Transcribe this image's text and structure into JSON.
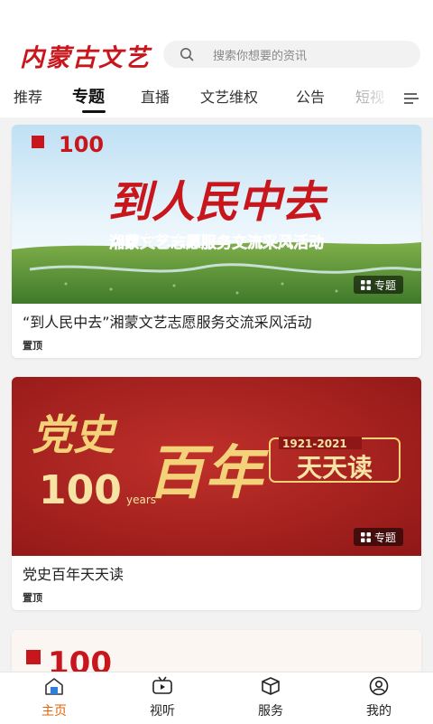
{
  "header": {
    "logo_text": "内蒙古文艺",
    "search_placeholder": "搜索你想要的资讯"
  },
  "tabs": [
    {
      "label": "推荐",
      "active": false
    },
    {
      "label": "专题",
      "active": true
    },
    {
      "label": "直播",
      "active": false
    },
    {
      "label": "文艺维权",
      "active": false
    },
    {
      "label": "公告",
      "active": false
    },
    {
      "label": "短视",
      "active": false
    }
  ],
  "cards": [
    {
      "banner_headline": "到人民中去",
      "banner_subheadline": "湘蒙文艺志愿服务交流采风活动",
      "badge": "专题",
      "title": "“到人民中去”湘蒙文艺志愿服务交流采风活动",
      "pin": "置顶"
    },
    {
      "banner_left_text": "党史",
      "banner_number": "100",
      "banner_years": "years",
      "banner_right_text": "百年",
      "banner_date_range": "1921-2021",
      "banner_daily": "天天读",
      "badge": "专题",
      "title": "党史百年天天读",
      "pin": "置顶"
    },
    {
      "banner_number": "100"
    }
  ],
  "bottom_nav": [
    {
      "label": "主页",
      "icon": "home-icon",
      "active": true
    },
    {
      "label": "视听",
      "icon": "tv-icon",
      "active": false
    },
    {
      "label": "服务",
      "icon": "cube-icon",
      "active": false
    },
    {
      "label": "我的",
      "icon": "user-icon",
      "active": false
    }
  ],
  "colors": {
    "brand_red": "#c8161d",
    "active_nav": "#e0620a",
    "banner2_red": "#a81d1d"
  }
}
